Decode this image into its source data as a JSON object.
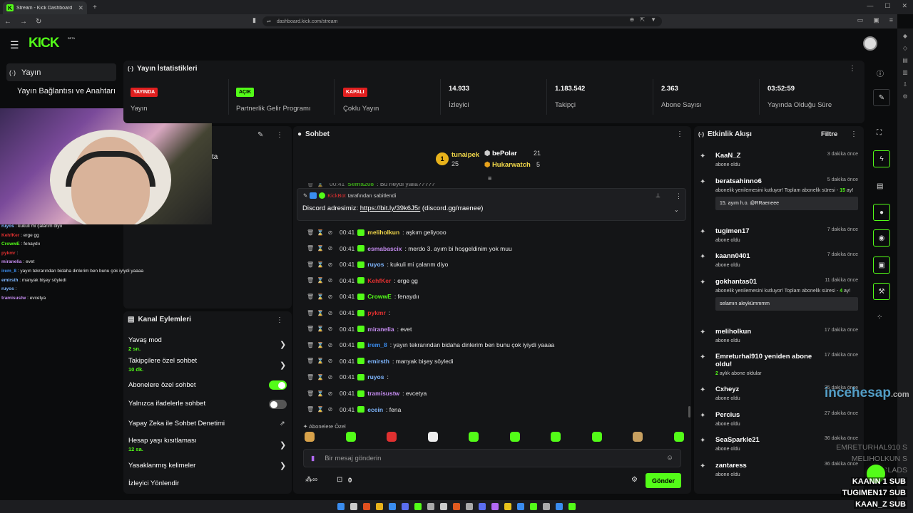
{
  "browser": {
    "tab_title": "Stream - Kick Dashboard",
    "url": "dashboard.kick.com/stream"
  },
  "kick": {
    "logo": "KICK",
    "beta": "BETA"
  },
  "nav": {
    "active": "Yayın",
    "item2": "Yayın Bağlantısı ve Anahtarı"
  },
  "stats": {
    "title": "Yayın İstatistikleri",
    "items": [
      {
        "badge": "YAYINDA",
        "badge_color": "#e01f1f",
        "label": "Yayın"
      },
      {
        "badge": "AÇIK",
        "badge_color": "#53fc18",
        "label": "Partnerlik Gelir Programı"
      },
      {
        "badge": "KAPALI",
        "badge_color": "#e01f1f",
        "label": "Çoklu Yayın"
      },
      {
        "value": "14.933",
        "label": "İzleyici"
      },
      {
        "value": "1.183.542",
        "label": "Takipçi"
      },
      {
        "value": "2.363",
        "label": "Abone Sayısı"
      },
      {
        "value": "03:52:59",
        "label": "Yayında Olduğu Süre"
      }
    ]
  },
  "old_chat": [
    {
      "user": "ruyos",
      "text": " : kukuli mi çalarım diyo",
      "color": "#7fb7ff"
    },
    {
      "user": "KehfKer",
      "text": " : erge gg",
      "color": "#e03030"
    },
    {
      "user": "CrowwE",
      "text": " : fenaydıı",
      "color": "#53fc18"
    },
    {
      "user": "pykmr",
      "text": " : ",
      "color": "#e03030"
    },
    {
      "user": "miranelia",
      "text": " : evet",
      "color": "#c58cf0"
    },
    {
      "user": "irem_8",
      "text": " : yayın tekrarından bidaha dinlerim ben bunu çok iyiydi yaaaa",
      "color": "#3a8df0"
    },
    {
      "user": "emirsth",
      "text": " : manyak bişey söyledi",
      "color": "#7fb7ff"
    },
    {
      "user": "ruyos",
      "text": " : ",
      "color": "#7fb7ff"
    },
    {
      "user": "tramisustw",
      "text": " : evcetya",
      "color": "#c58cf0"
    }
  ],
  "left_panel": {
    "partial": "ta"
  },
  "chat": {
    "title": "Sohbet",
    "leaderboard": [
      {
        "rank": "1",
        "name": "tunaipek",
        "count": "25"
      },
      {
        "name": "bePolar",
        "count": "21"
      },
      {
        "name": "Hukarwatch",
        "count": "5"
      }
    ],
    "cut_row": {
      "time": "00:41",
      "user": "Sema208",
      "text": ": Bu neydi yaiia?????"
    },
    "pinned": {
      "by_user": "KickBot",
      "by_text": " tarafından sabitlendi",
      "prefix": "Discord adresimiz: ",
      "link": "https://bit.ly/39k6J5r",
      "suffix": " (discord.gg/rraenee)"
    },
    "messages": [
      {
        "time": "00:41",
        "user": "meliholkun",
        "text": ": aşkım geliyooo",
        "color": "#f3d94a"
      },
      {
        "time": "00:41",
        "user": "esmabascix",
        "text": ": merdo 3. ayım bi hoşgeldinim yok muu",
        "color": "#c58cf0"
      },
      {
        "time": "00:41",
        "user": "ruyos",
        "text": ": kukuli mi çalarım diyo",
        "color": "#7fb7ff"
      },
      {
        "time": "00:41",
        "user": "KehfKer",
        "text": ": erge gg",
        "color": "#e03030"
      },
      {
        "time": "00:41",
        "user": "CrowwE",
        "text": ": fenaydıı",
        "color": "#53fc18"
      },
      {
        "time": "00:41",
        "user": "pykmr",
        "text": ":",
        "color": "#e03030"
      },
      {
        "time": "00:41",
        "user": "miranelia",
        "text": ": evet",
        "color": "#c58cf0"
      },
      {
        "time": "00:41",
        "user": "irem_8",
        "text": ": yayın tekrarından bidaha dinlerim ben bunu çok iyiydi yaaaa",
        "color": "#3a8df0"
      },
      {
        "time": "00:41",
        "user": "emirsth",
        "text": ": manyak bişey söyledi",
        "color": "#7fb7ff"
      },
      {
        "time": "00:41",
        "user": "ruyos",
        "text": ":",
        "color": "#7fb7ff"
      },
      {
        "time": "00:41",
        "user": "tramisustw",
        "text": ": evcetya",
        "color": "#c58cf0"
      },
      {
        "time": "00:41",
        "user": "ecein",
        "text": ": fena",
        "color": "#7fb7ff"
      }
    ],
    "emote_tab": "Abonelere Özel",
    "input_placeholder": "Bir mesaj gönderin",
    "points": "0",
    "send": "Gönder"
  },
  "activity": {
    "title": "Etkinlik Akışı",
    "filter": "Filtre",
    "items": [
      {
        "name": "KaaN_Z",
        "sub": "abone oldu",
        "time": "3 dakika önce"
      },
      {
        "name": "beratsahinno6",
        "sub": "abonelik yenilemesini kutluyor! Toplam abonelik süresi - ",
        "months": "15",
        "after": " ay!",
        "time": "5 dakika önce",
        "box": "15. ayım h.o. @RRaeneee"
      },
      {
        "name": "tugimen17",
        "sub": "abone oldu",
        "time": "7 dakika önce"
      },
      {
        "name": "kaann0401",
        "sub": "abone oldu",
        "time": "7 dakika önce"
      },
      {
        "name": "gokhantas01",
        "sub": "abonelik yenilemesini kutluyor! Toplam abonelik süresi - ",
        "months": "4",
        "after": " ay!",
        "time": "11 dakika önce",
        "box": "selamın aleykümmmm"
      },
      {
        "name": "meliholkun",
        "sub": "abone oldu",
        "time": "17 dakika önce"
      },
      {
        "name": "Emreturhal910 yeniden abone oldu!",
        "sub": "aylık abone oldular",
        "months": "2",
        "time": "17 dakika önce"
      },
      {
        "name": "Cxheyz",
        "sub": "abone oldu",
        "time": "25 dakika önce"
      },
      {
        "name": "Percius",
        "sub": "abone oldu",
        "time": "27 dakika önce"
      },
      {
        "name": "SeaSparkle21",
        "sub": "abone oldu",
        "time": "36 dakika önce"
      },
      {
        "name": "zantaress",
        "sub": "abone oldu",
        "time": "36 dakika önce"
      }
    ]
  },
  "channel_actions": {
    "title": "Kanal Eylemleri",
    "items": [
      {
        "label": "Yavaş mod",
        "sub": "2 sn."
      },
      {
        "label": "Takipçilere özel sohbet",
        "sub": "10 dk."
      },
      {
        "label": "Abonelere özel sohbet",
        "toggle": true
      },
      {
        "label": "Yalnızca ifadelerle sohbet",
        "toggle": false
      },
      {
        "label": "Yapay Zeka ile Sohbet Denetimi"
      },
      {
        "label": "Hesap yaşı kısıtlaması",
        "sub": "12 sa."
      },
      {
        "label": "Yasaklanmış kelimeler"
      },
      {
        "label": "İzleyici Yönlendir"
      }
    ]
  },
  "overlay": {
    "watermark": "incehesap",
    "watermark_suffix": ".com",
    "ghost1": "EMRETURHAL910 S",
    "ghost2": "MELIHOLKUN S",
    "ghost3": "GLADS",
    "sub1": "KAANN  1 SUB",
    "sub2": "TUGIMEN17 SUB",
    "sub3": "KAAN_Z SUB"
  }
}
